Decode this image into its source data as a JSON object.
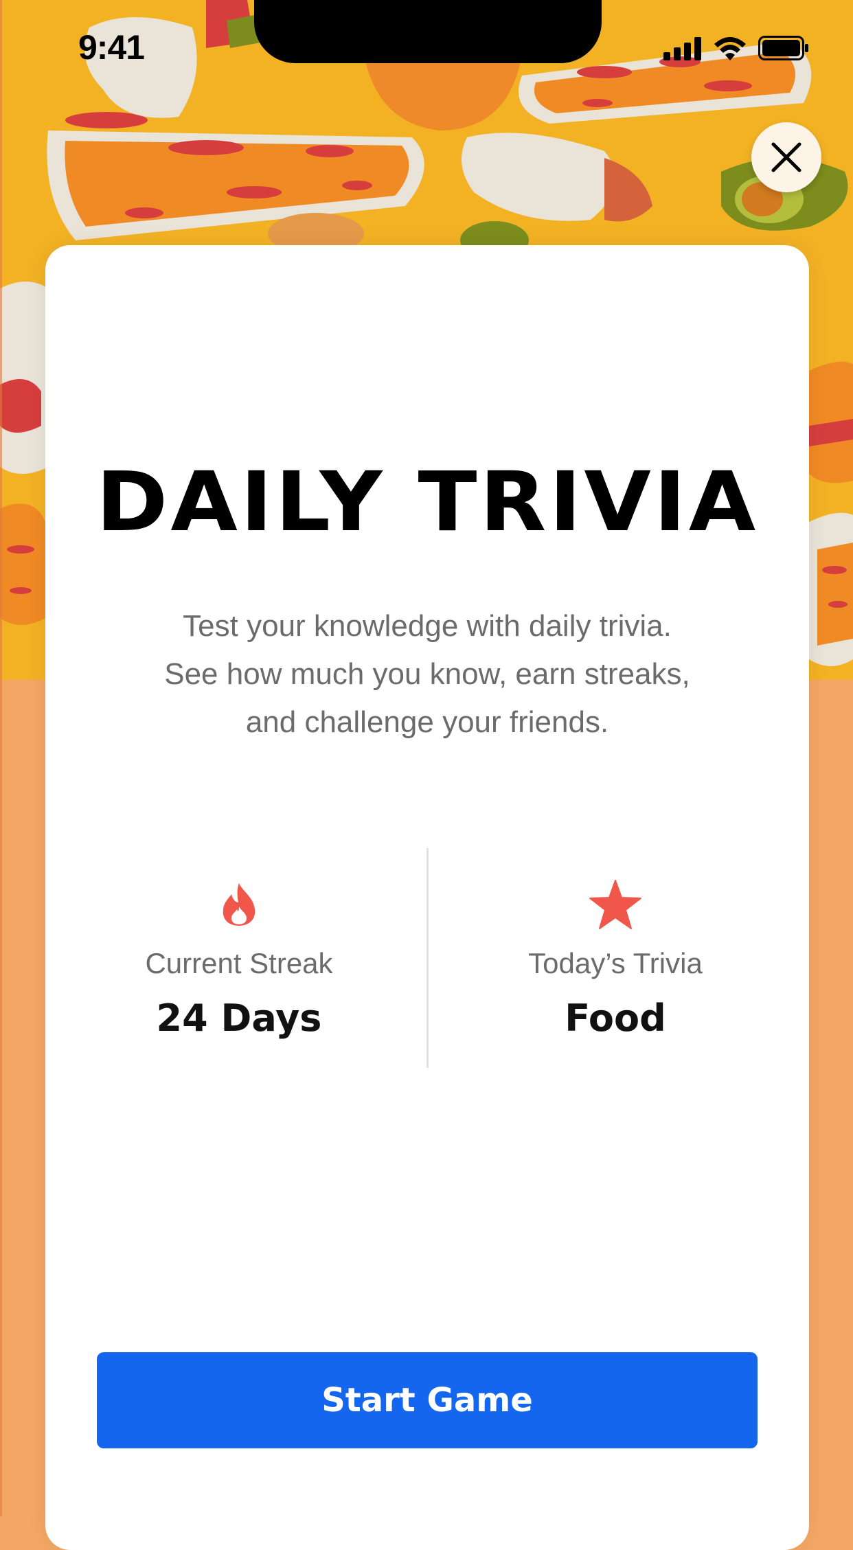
{
  "status_bar": {
    "time": "9:41"
  },
  "icons": {
    "close": "close-icon",
    "streak": "flame-icon",
    "trivia": "star-icon"
  },
  "colors": {
    "background_top": "#F2B224",
    "background_bottom": "#F4A765",
    "accent_red": "#F0564A",
    "button_blue": "#1466EE",
    "card": "#FFFFFF"
  },
  "title": "DAILY TRIVIA",
  "description": {
    "line1": "Test your knowledge with daily trivia.",
    "line2": "See how much you know, earn streaks,",
    "line3": "and challenge your friends."
  },
  "stats": {
    "streak": {
      "label": "Current Streak",
      "value": "24 Days"
    },
    "topic": {
      "label": "Today’s Trivia",
      "value": "Food"
    }
  },
  "actions": {
    "start": "Start Game"
  }
}
